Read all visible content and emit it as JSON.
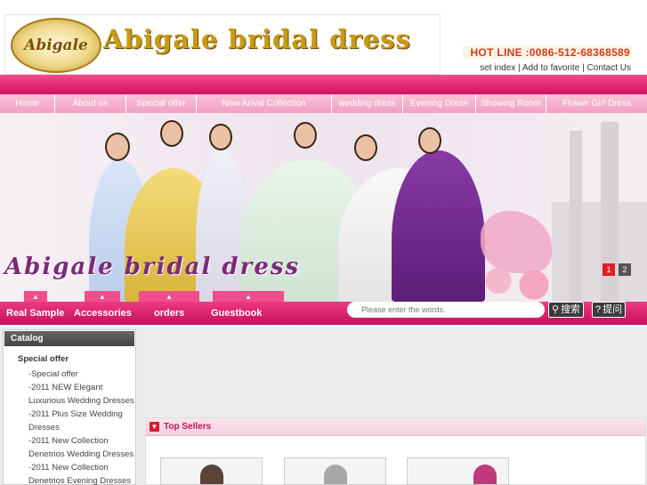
{
  "header": {
    "logo_emblem_text": "Abigale",
    "logo_title": "Abigale bridal dress",
    "hotline": "HOT LINE :0086-512-68368589",
    "links": [
      "set index",
      "Add to favorite",
      "Contact Us"
    ]
  },
  "nav": {
    "items": [
      {
        "label": "Home"
      },
      {
        "label": "About us"
      },
      {
        "label": "Special offer"
      },
      {
        "label": "New Arival Collection"
      },
      {
        "label": "wedding dress"
      },
      {
        "label": "Evening Dress"
      },
      {
        "label": "Showing Room"
      },
      {
        "label": "Flower Girl Dress"
      }
    ]
  },
  "banner": {
    "caption": "Abigale bridal dress",
    "slides": [
      "1",
      "2"
    ]
  },
  "subbar": {
    "items": [
      "Real Sample",
      "Accessories",
      "orders",
      "Guestbook"
    ],
    "search_placeholder": "Please enter the words.",
    "search_button": "搜索",
    "ask_button": "提问"
  },
  "catalog": {
    "title": "Catalog",
    "section": "Special offer",
    "items": [
      "-Special offer",
      "-2011 NEW Elegant",
      "Luxurious Wedding Dresses",
      "-2011 Plus Size Wedding",
      "Dresses",
      "-2011 New Collection",
      "Denetrios Wedding Dresses",
      "-2011 New Collection",
      "Denetrios Evening Dresses"
    ]
  },
  "top_sellers": {
    "title": "Top Sellers"
  },
  "colors": {
    "brand_pink": "#e0266e",
    "nav_light_pink": "#f4a9c6",
    "gold": "#c99a14",
    "hotline_red": "#d23b1b"
  }
}
